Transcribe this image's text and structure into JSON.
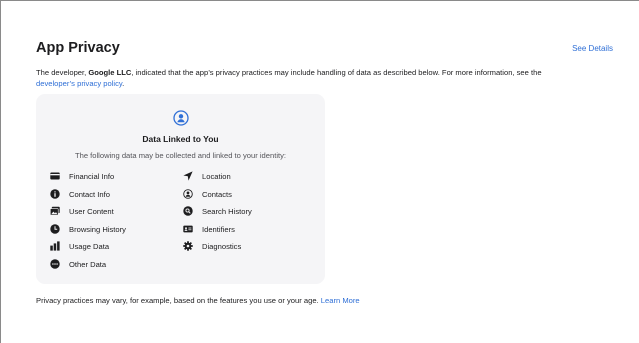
{
  "header": {
    "title": "App Privacy",
    "see_details": "See Details"
  },
  "description": {
    "prefix": "The developer, ",
    "developer": "Google LLC",
    "middle": ", indicated that the app’s privacy practices may include handling of data as described below. For more information, see the",
    "link": "developer’s privacy policy",
    "suffix": "."
  },
  "card": {
    "icon": "person-circle-icon",
    "title": "Data Linked to You",
    "subtitle": "The following data may be collected and linked to your identity:",
    "left_items": [
      {
        "label": "Financial Info",
        "icon": "credit-card-icon"
      },
      {
        "label": "Contact Info",
        "icon": "info-circle-icon"
      },
      {
        "label": "User Content",
        "icon": "photo-icon"
      },
      {
        "label": "Browsing History",
        "icon": "clock-icon"
      },
      {
        "label": "Usage Data",
        "icon": "bar-chart-icon"
      },
      {
        "label": "Other Data",
        "icon": "more-circle-icon"
      }
    ],
    "right_items": [
      {
        "label": "Location",
        "icon": "location-arrow-icon"
      },
      {
        "label": "Contacts",
        "icon": "person-circle-icon"
      },
      {
        "label": "Search History",
        "icon": "search-circle-icon"
      },
      {
        "label": "Identifiers",
        "icon": "id-card-icon"
      },
      {
        "label": "Diagnostics",
        "icon": "gear-icon"
      }
    ]
  },
  "footer": {
    "text": "Privacy practices may vary, for example, based on the features you use or your age.",
    "link": "Learn More"
  },
  "colors": {
    "accent": "#2f6fd6",
    "card_bg": "#f5f5f7",
    "text": "#1d1d1f"
  }
}
